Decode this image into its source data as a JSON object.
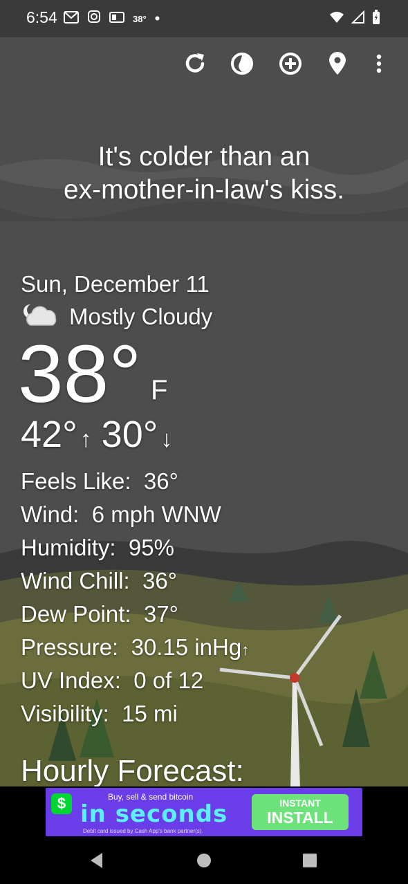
{
  "status_bar": {
    "time": "6:54",
    "temp_badge": "38°",
    "dot": "•",
    "icons": [
      "gmail-icon",
      "instagram-icon",
      "news-icon"
    ],
    "right_icons": [
      "wifi-icon",
      "signal-icon",
      "battery-icon"
    ]
  },
  "toolbar": {
    "buttons": [
      "refresh-icon",
      "theme-icon",
      "add-location-icon",
      "location-pin-icon",
      "more-vert-icon"
    ]
  },
  "quote": {
    "line1": "It's colder than an",
    "line2": "ex-mother-in-law's kiss."
  },
  "weather": {
    "date": "Sun, December 11",
    "condition": "Mostly Cloudy",
    "condition_icon": "partly-cloudy-night-icon",
    "temperature": "38°",
    "unit": "F",
    "high": "42°",
    "high_arrow": "↑",
    "low": "30°",
    "low_arrow": "↓",
    "stats": [
      {
        "label": "Feels Like:",
        "value": "36°",
        "suffix": ""
      },
      {
        "label": "Wind:",
        "value": "6 mph WNW",
        "suffix": ""
      },
      {
        "label": "Humidity:",
        "value": "95%",
        "suffix": ""
      },
      {
        "label": "Wind Chill:",
        "value": "36°",
        "suffix": ""
      },
      {
        "label": "Dew Point:",
        "value": "37°",
        "suffix": ""
      },
      {
        "label": "Pressure:",
        "value": "30.15 inHg",
        "suffix": "↑"
      },
      {
        "label": "UV Index:",
        "value": "0 of 12",
        "suffix": ""
      },
      {
        "label": "Visibility:",
        "value": "15 mi",
        "suffix": ""
      }
    ],
    "hourly_title": "Hourly Forecast:"
  },
  "ad": {
    "logo": "$",
    "top_line": "Buy, sell & send bitcoin",
    "headline": "in seconds",
    "fine_print": "Debit card issued by Cash App's bank partner(s).",
    "button_line1": "INSTANT",
    "button_line2": "INSTALL",
    "colors": {
      "background": "#6a3de8",
      "headline": "#5cf0ff",
      "button": "#6ee27a",
      "logo": "#00d632"
    }
  },
  "nav_bar": {
    "buttons": [
      "back-icon",
      "home-icon",
      "recents-icon"
    ]
  }
}
